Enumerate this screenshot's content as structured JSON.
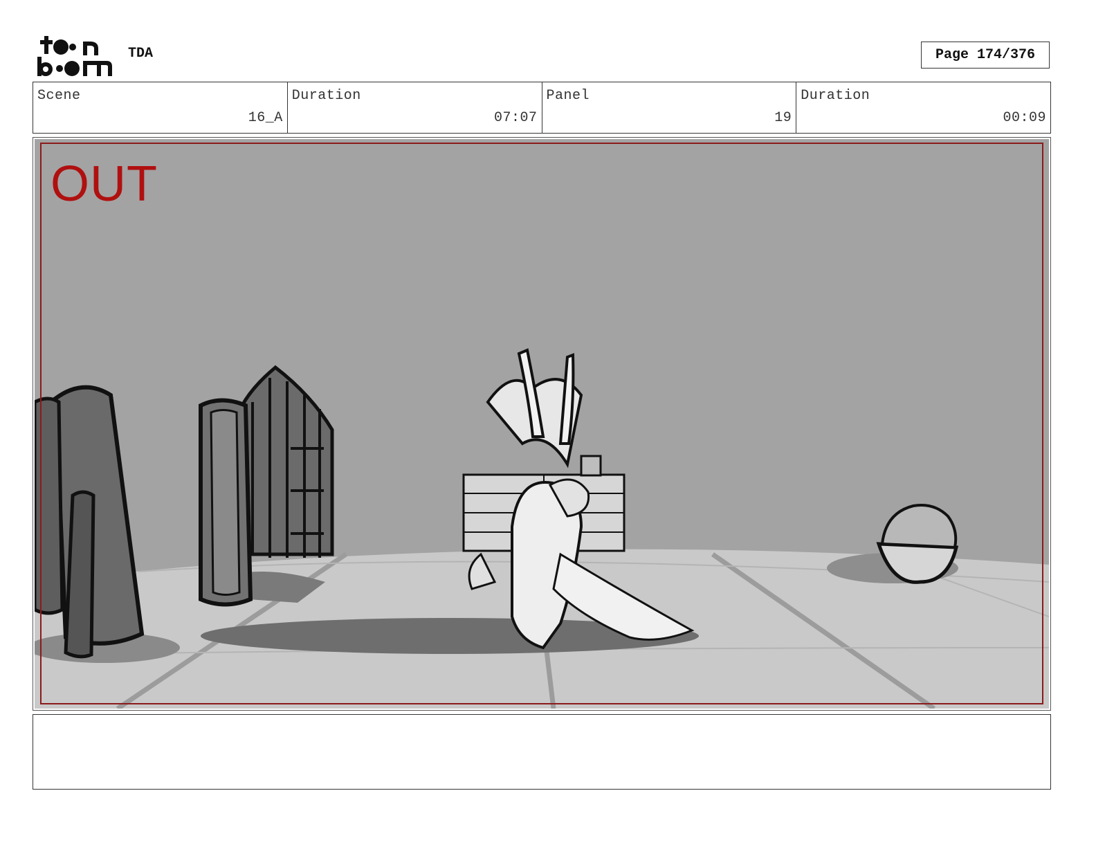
{
  "header": {
    "logo": {
      "text_top": "toon",
      "text_bottom": "boom",
      "icon": "toon-boom-logo"
    },
    "project": "TDA",
    "page": "Page 174/376"
  },
  "info": {
    "scene_label": "Scene",
    "scene_value": "16_A",
    "scene_duration_label": "Duration",
    "scene_duration_value": "07:07",
    "panel_label": "Panel",
    "panel_value": "19",
    "panel_duration_label": "Duration",
    "panel_duration_value": "00:09"
  },
  "panel": {
    "overlay_text": "OUT",
    "overlay_color": "#b01010",
    "frame_color": "#8b1a1a",
    "image_description_icon": "storyboard-sketch"
  },
  "notes": {
    "text": ""
  }
}
